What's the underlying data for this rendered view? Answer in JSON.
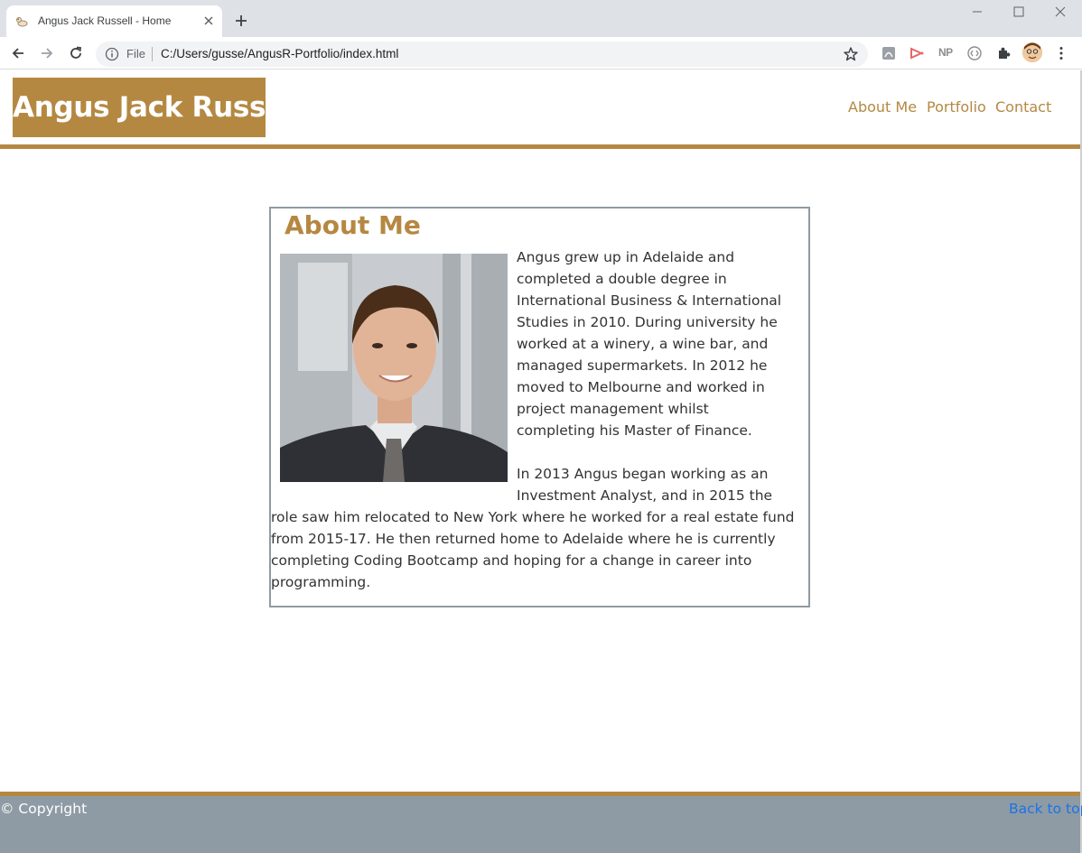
{
  "browser": {
    "tab_title": "Angus Jack Russell - Home",
    "address_prefix": "File",
    "url": "C:/Users/gusse/AngusR-Portfolio/index.html",
    "extension_np": "NP"
  },
  "site": {
    "logo": "Angus Jack Russell",
    "nav": [
      "About Me",
      "Portfolio",
      "Contact"
    ],
    "accent": "#b58842"
  },
  "about": {
    "heading": "About Me",
    "lines": [
      "Angus grew up in Adelaide and",
      "completed a double degree in",
      "International Business & International",
      "Studies in 2010. During university he",
      "worked at a winery, a wine bar, and",
      "managed supermarkets. In 2012 he",
      "moved to Melbourne and worked in",
      "project management whilst",
      "completing his Master of Finance.",
      "In 2013 Angus began working as an",
      "Investment Analyst, and in 2015 the",
      "role saw him relocated to New York where he worked for a real estate fund",
      "from 2015-17. He then returned home to Adelaide where he is currently",
      "completing Coding Bootcamp and hoping for a change in career into",
      "programming."
    ]
  },
  "footer": {
    "copyright": "© Copyright",
    "back_to_top": "Back to top"
  }
}
